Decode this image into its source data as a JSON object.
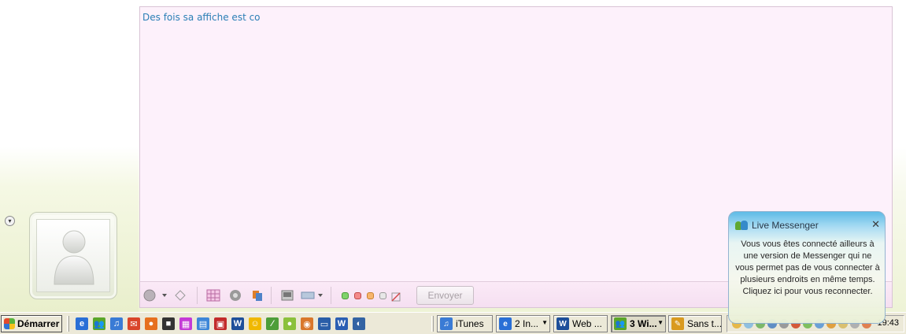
{
  "conversation": {
    "message_draft": "Des fois sa affiche est co",
    "expand_glyph": "▾",
    "toolbar": {
      "send_label": "Envoyer"
    }
  },
  "taskbar": {
    "start_label": "Démarrer",
    "quick_launch": [
      {
        "name": "internet-explorer-icon",
        "glyph": "e",
        "color": "#2a6fd6"
      },
      {
        "name": "messenger-icon",
        "glyph": "👥",
        "color": "#5aa62a"
      },
      {
        "name": "itunes-icon",
        "glyph": "♫",
        "color": "#3a7bd5"
      },
      {
        "name": "mail-icon",
        "glyph": "✉",
        "color": "#d9452b"
      },
      {
        "name": "firefox-icon",
        "glyph": "●",
        "color": "#e6701f"
      },
      {
        "name": "media-icon",
        "glyph": "■",
        "color": "#333333"
      },
      {
        "name": "color-icon",
        "glyph": "▦",
        "color": "#c43ad6"
      },
      {
        "name": "file-icon",
        "glyph": "▤",
        "color": "#3d86d8"
      },
      {
        "name": "pdf-icon",
        "glyph": "▣",
        "color": "#c22b2b"
      },
      {
        "name": "web-icon",
        "glyph": "W",
        "color": "#1e4f9a"
      },
      {
        "name": "smiley-icon",
        "glyph": "☺",
        "color": "#f0b800"
      },
      {
        "name": "brush-icon",
        "glyph": "⁄",
        "color": "#4d9e39"
      },
      {
        "name": "shell-icon",
        "glyph": "●",
        "color": "#8bc13c"
      },
      {
        "name": "chrome-icon",
        "glyph": "◉",
        "color": "#d9772b"
      },
      {
        "name": "window-icon",
        "glyph": "▭",
        "color": "#2a5ea8"
      },
      {
        "name": "word-icon",
        "glyph": "W",
        "color": "#2b5fb3"
      },
      {
        "name": "audio-icon",
        "glyph": "◐",
        "color": "#3363a3"
      }
    ],
    "tasks": [
      {
        "label": "iTunes",
        "icon": "itunes-icon",
        "glyph": "♫",
        "color": "#3a7bd5"
      },
      {
        "label": "2 In...",
        "icon": "internet-explorer-icon",
        "glyph": "e",
        "color": "#2a6fd6"
      },
      {
        "label": "Web ...",
        "icon": "web-icon",
        "glyph": "W",
        "color": "#1e4f9a"
      },
      {
        "label": "3 Wi...",
        "icon": "messenger-icon",
        "glyph": "👥",
        "color": "#5aa62a"
      },
      {
        "label": "Sans t...",
        "icon": "paint-icon",
        "glyph": "✎",
        "color": "#d99a1f"
      }
    ],
    "clock": "19:43"
  },
  "notification": {
    "title": "Live Messenger",
    "close_glyph": "✕",
    "body": "Vous vous êtes connecté ailleurs à une version de Messenger qui ne vous permet pas de vous connecter à plusieurs endroits en même temps. Cliquez ici pour vous reconnecter."
  },
  "colors": {
    "message_text": "#2b7fb6",
    "compose_bg": "#fdf1fb",
    "taskbar_bg": "#ece9d8"
  }
}
